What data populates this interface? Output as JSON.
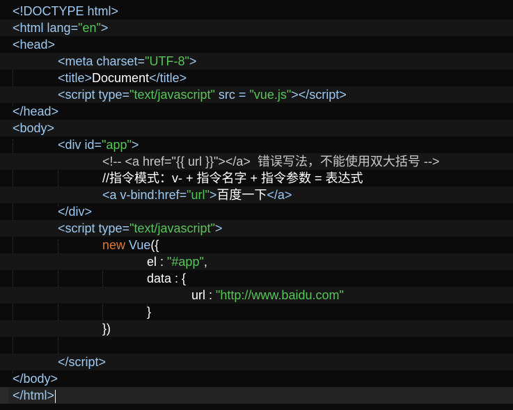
{
  "editor": {
    "lines": [
      [
        {
          "t": "<!DOCTYPE html>",
          "c": "t"
        }
      ],
      [
        {
          "t": "<html ",
          "c": "t"
        },
        {
          "t": "lang=",
          "c": "t"
        },
        {
          "t": "\"en\"",
          "c": "s"
        },
        {
          "t": ">",
          "c": "t"
        }
      ],
      [
        {
          "t": "<head>",
          "c": "t"
        }
      ],
      [
        {
          "t": "<meta ",
          "c": "t"
        },
        {
          "t": "charset=",
          "c": "t"
        },
        {
          "t": "\"UTF-8\"",
          "c": "s"
        },
        {
          "t": ">",
          "c": "t"
        }
      ],
      [
        {
          "t": "<title>",
          "c": "t"
        },
        {
          "t": "Document",
          "c": "w"
        },
        {
          "t": "</title>",
          "c": "t"
        }
      ],
      [
        {
          "t": "<script ",
          "c": "t"
        },
        {
          "t": "type=",
          "c": "t"
        },
        {
          "t": "\"text/javascript\"",
          "c": "s"
        },
        {
          "t": " src = ",
          "c": "t"
        },
        {
          "t": "\"vue.js\"",
          "c": "s"
        },
        {
          "t": "></",
          "c": "t"
        },
        {
          "t": "script>",
          "c": "t"
        }
      ],
      [
        {
          "t": "</head>",
          "c": "t"
        }
      ],
      [
        {
          "t": "<body>",
          "c": "t"
        }
      ],
      [
        {
          "t": "<div ",
          "c": "t"
        },
        {
          "t": "id=",
          "c": "t"
        },
        {
          "t": "\"app\"",
          "c": "s"
        },
        {
          "t": ">",
          "c": "t"
        }
      ],
      [
        {
          "t": "<!-- <a href=\"{{ url }}\"></a>  错误写法，不能使用双大括号 -->",
          "c": "c"
        }
      ],
      [
        {
          "t": "//指令模式：v- + 指令名字 + 指令参数 = 表达式",
          "c": "w"
        }
      ],
      [
        {
          "t": "<a ",
          "c": "t"
        },
        {
          "t": "v-bind:href=",
          "c": "t"
        },
        {
          "t": "\"url\"",
          "c": "s"
        },
        {
          "t": ">",
          "c": "t"
        },
        {
          "t": "百度一下",
          "c": "w"
        },
        {
          "t": "</a>",
          "c": "t"
        }
      ],
      [
        {
          "t": "</div>",
          "c": "t"
        }
      ],
      [
        {
          "t": "<script ",
          "c": "t"
        },
        {
          "t": "type=",
          "c": "t"
        },
        {
          "t": "\"text/javascript\"",
          "c": "s"
        },
        {
          "t": ">",
          "c": "t"
        }
      ],
      [
        {
          "t": "new ",
          "c": "k"
        },
        {
          "t": "Vue",
          "c": "f"
        },
        {
          "t": "({",
          "c": "w"
        }
      ],
      [
        {
          "t": "el : ",
          "c": "w"
        },
        {
          "t": "\"#app\"",
          "c": "s"
        },
        {
          "t": ",",
          "c": "w"
        }
      ],
      [
        {
          "t": "data : {",
          "c": "w"
        }
      ],
      [
        {
          "t": "url : ",
          "c": "w"
        },
        {
          "t": "\"http://www.baidu.com\"",
          "c": "s"
        }
      ],
      [
        {
          "t": "}",
          "c": "w"
        }
      ],
      [
        {
          "t": "})",
          "c": "w"
        }
      ],
      [],
      [
        {
          "t": "</",
          "c": "t"
        },
        {
          "t": "script>",
          "c": "t"
        }
      ],
      [
        {
          "t": "</body>",
          "c": "t"
        }
      ],
      [
        {
          "t": "</html>",
          "c": "t"
        }
      ]
    ],
    "current_line": 24
  }
}
